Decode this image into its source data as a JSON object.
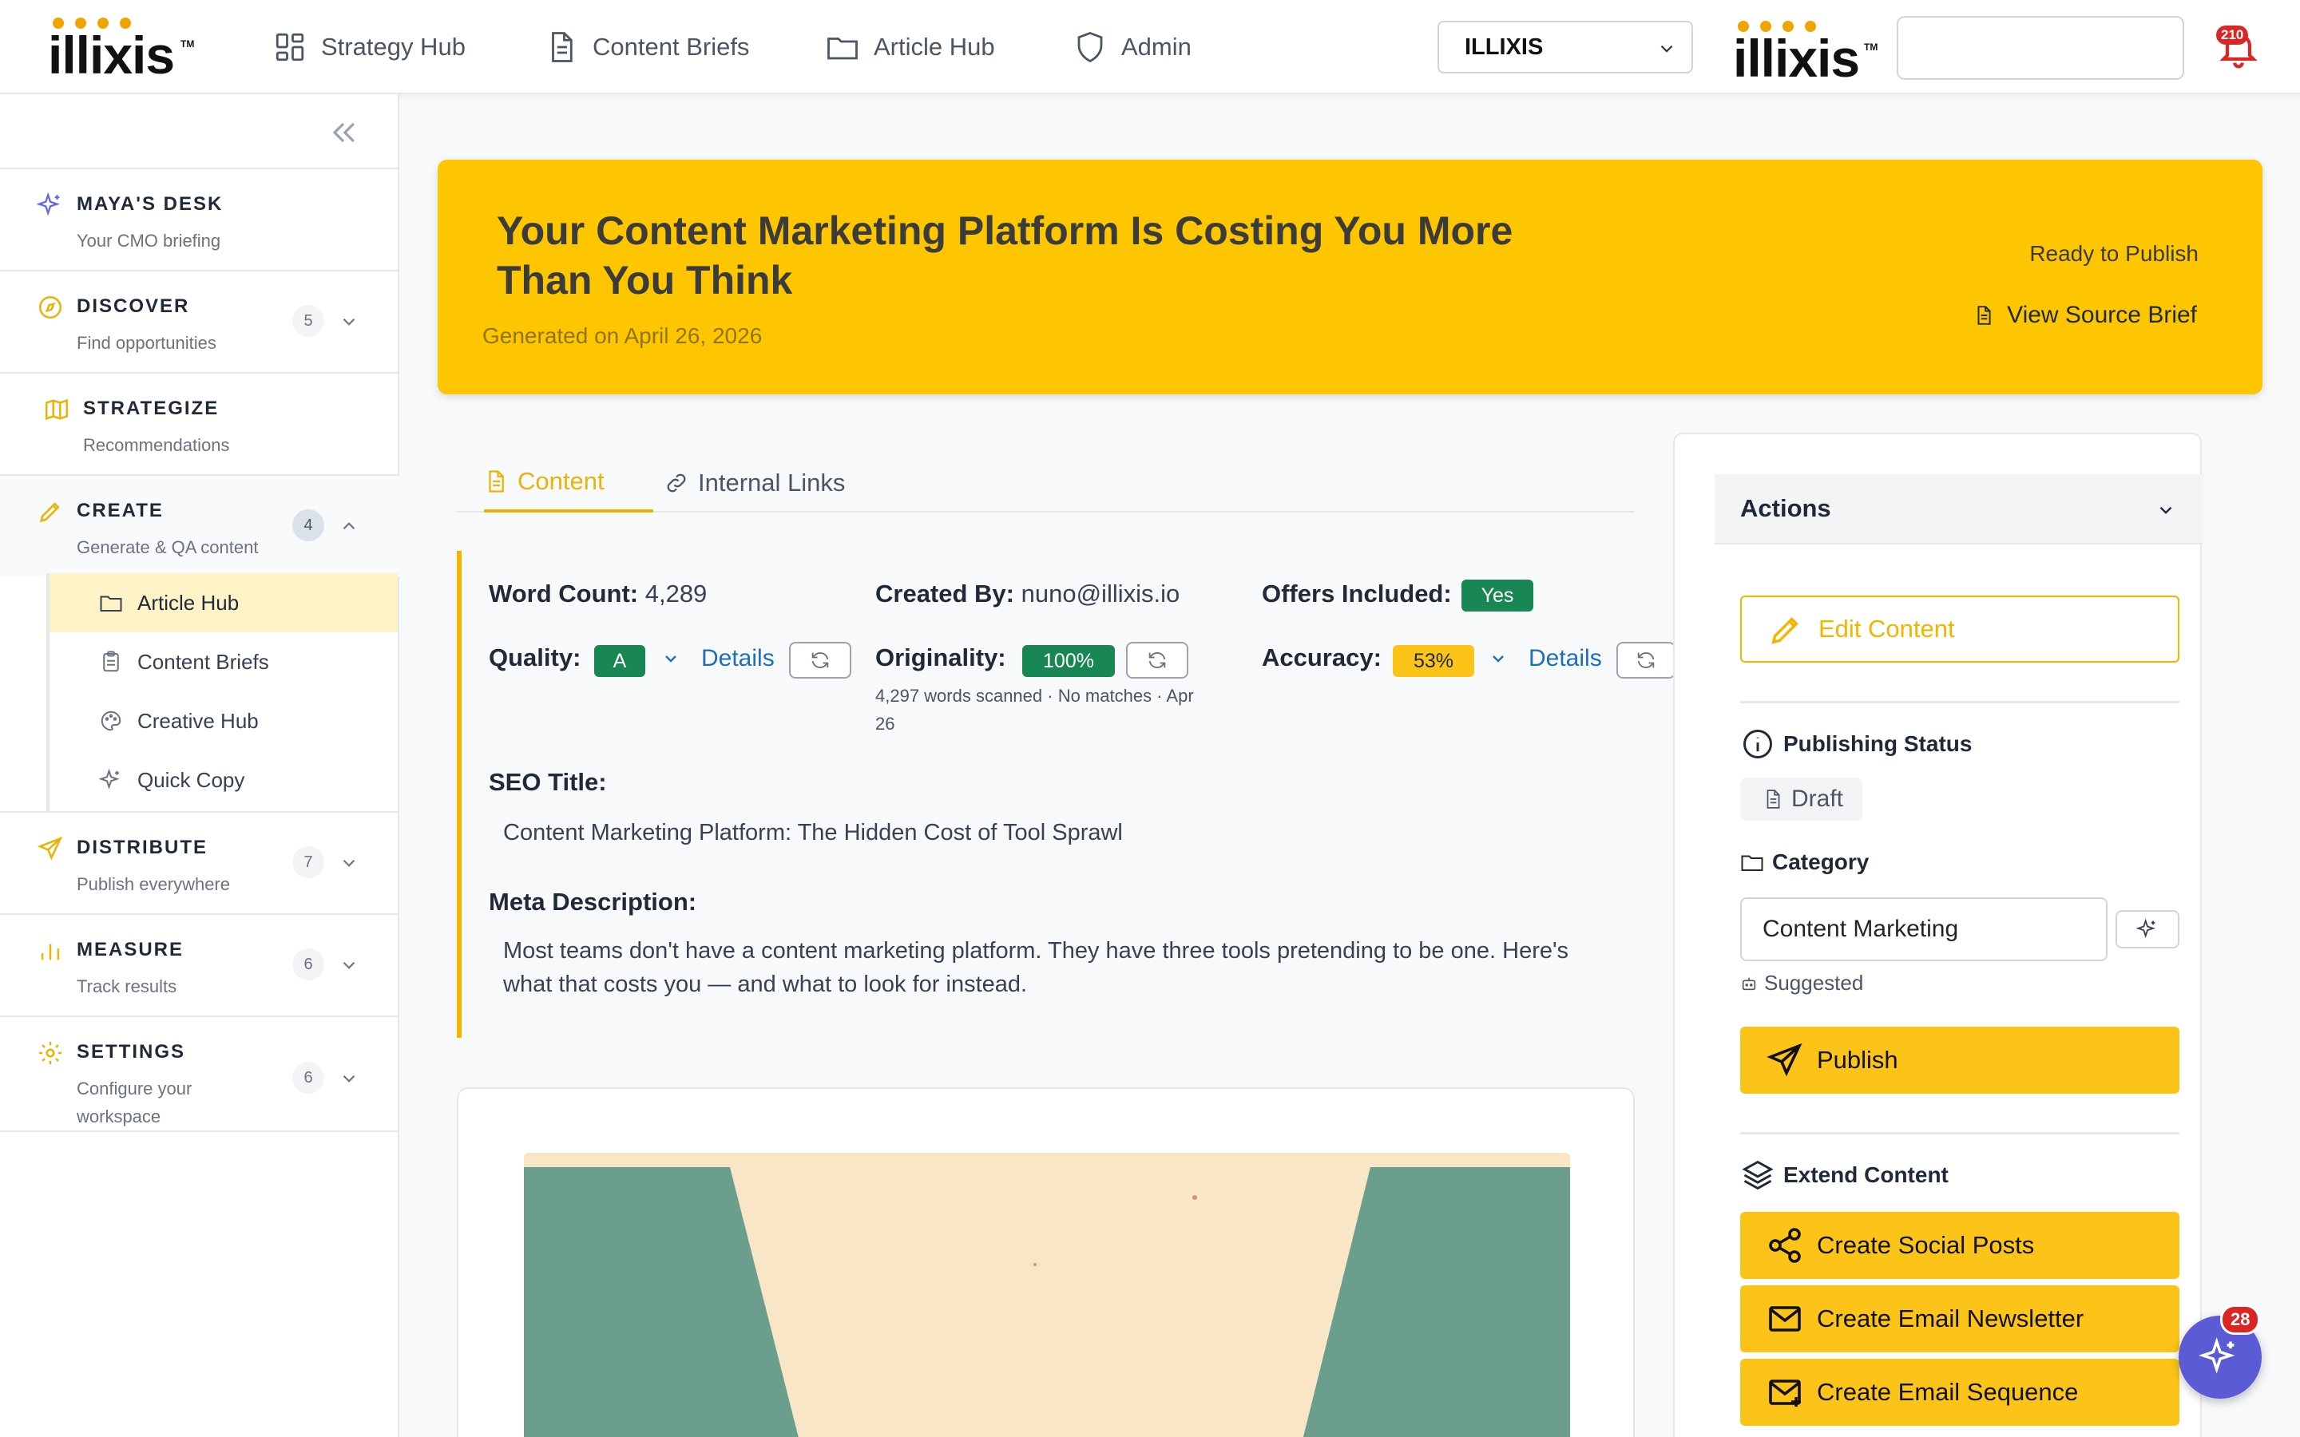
{
  "brand": {
    "logo_text": "illixis",
    "tm": "TM"
  },
  "nav": {
    "items": [
      {
        "label": "Strategy Hub",
        "icon": "grid-icon"
      },
      {
        "label": "Content Briefs",
        "icon": "document-icon"
      },
      {
        "label": "Article Hub",
        "icon": "folder-icon"
      },
      {
        "label": "Admin",
        "icon": "shield-icon"
      }
    ],
    "org_select": {
      "value": "ILLIXIS"
    },
    "notifications_count": "210"
  },
  "sidebar": {
    "sections": [
      {
        "title": "MAYA'S DESK",
        "sub": "Your CMO briefing",
        "icon": "sparkle-icon"
      },
      {
        "title": "DISCOVER",
        "sub": "Find opportunities",
        "count": "5",
        "icon": "compass-icon"
      },
      {
        "title": "STRATEGIZE",
        "sub": "Recommendations",
        "icon": "map-icon"
      },
      {
        "title": "CREATE",
        "sub": "Generate & QA content",
        "count": "4",
        "icon": "pen-icon"
      },
      {
        "title": "DISTRIBUTE",
        "sub": "Publish everywhere",
        "count": "7",
        "icon": "send-icon"
      },
      {
        "title": "MEASURE",
        "sub": "Track results",
        "count": "6",
        "icon": "bar-chart-icon"
      },
      {
        "title": "SETTINGS",
        "sub_line1": "Configure your",
        "sub_line2": "workspace",
        "count": "6",
        "icon": "gear-icon"
      }
    ],
    "create_items": [
      {
        "label": "Article Hub",
        "icon": "folder-icon"
      },
      {
        "label": "Content Briefs",
        "icon": "clipboard-icon"
      },
      {
        "label": "Creative Hub",
        "icon": "palette-icon"
      },
      {
        "label": "Quick Copy",
        "icon": "sparkle-icon"
      }
    ]
  },
  "hero": {
    "title": "Your Content Marketing Platform Is Costing You More Than You Think",
    "generated": "Generated on April 26, 2026",
    "status": "Ready to Publish",
    "source_brief": "View Source Brief",
    "bg_color": "#fdc600"
  },
  "tabs": [
    {
      "label": "Content",
      "active": true
    },
    {
      "label": "Internal Links",
      "active": false
    }
  ],
  "meta": {
    "word_count_label": "Word Count:",
    "word_count": "4,289",
    "created_by_label": "Created By:",
    "created_by": "nuno@illixis.io",
    "offers_label": "Offers Included:",
    "offers": "Yes",
    "quality_label": "Quality:",
    "quality": "A",
    "originality_label": "Originality:",
    "originality": "100%",
    "originality_note_1": "4,297 words scanned · No matches · Apr",
    "originality_note_2": "26",
    "accuracy_label": "Accuracy:",
    "accuracy": "53%",
    "details_label": "Details",
    "seo_title_label": "SEO Title:",
    "seo_title": "Content Marketing Platform: The Hidden Cost of Tool Sprawl",
    "meta_desc_label": "Meta Description:",
    "meta_desc_1": "Most teams don't have a content marketing platform. They have three tools pretending to be one. Here's",
    "meta_desc_2": "what that costs you — and what to look for instead."
  },
  "actions": {
    "header": "Actions",
    "edit_content": "Edit Content",
    "publishing_status_label": "Publishing Status",
    "status": "Draft",
    "category_label": "Category",
    "category_value": "Content Marketing",
    "suggested": "Suggested",
    "publish": "Publish",
    "extend_label": "Extend Content",
    "social": "Create Social Posts",
    "newsletter": "Create Email Newsletter",
    "sequence": "Create Email Sequence"
  },
  "assistant_badge": "28",
  "colors": {
    "accent": "#fcc419",
    "success": "#198754",
    "link": "#1d6fb8"
  }
}
